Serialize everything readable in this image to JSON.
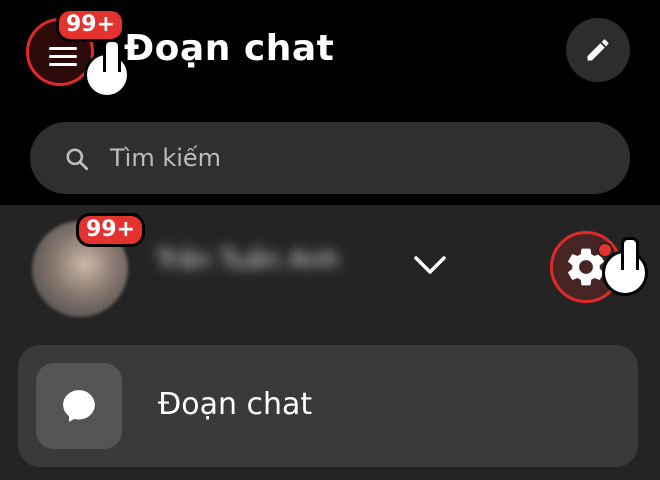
{
  "header": {
    "title": "Đoạn chat",
    "menu_badge": "99+",
    "menu_icon": "hamburger-icon",
    "compose_icon": "pencil-icon"
  },
  "search": {
    "placeholder": "Tìm kiếm",
    "icon": "search-icon"
  },
  "account": {
    "badge": "99+",
    "name": "Trần Tuấn Anh",
    "chevron_icon": "chevron-down-icon",
    "settings_icon": "gear-icon"
  },
  "menu": {
    "items": [
      {
        "label": "Đoạn chat",
        "icon": "chat-bubble-icon"
      }
    ]
  },
  "colors": {
    "background": "#000000",
    "panel": "#242424",
    "card": "#3a3a3a",
    "badge": "#e4322f",
    "highlight_ring": "#e02a2a"
  }
}
